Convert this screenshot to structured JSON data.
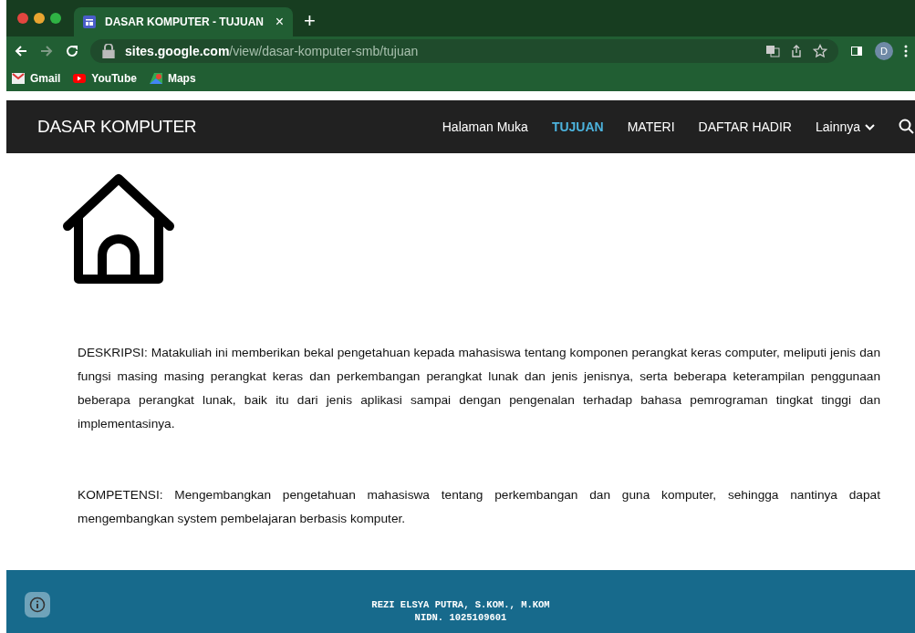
{
  "browser": {
    "tab_title": "DASAR KOMPUTER - TUJUAN",
    "tab_close": "×",
    "new_tab": "+",
    "url_host": "sites.google.com",
    "url_path": "/view/dasar-komputer-smb/tujuan",
    "profile_initial": "D",
    "bookmarks": [
      "Gmail",
      "YouTube",
      "Maps"
    ]
  },
  "site": {
    "title": "DASAR KOMPUTER",
    "nav": [
      {
        "label": "Halaman Muka",
        "selected": false
      },
      {
        "label": "TUJUAN",
        "selected": true
      },
      {
        "label": "MATERI",
        "selected": false
      },
      {
        "label": "DAFTAR HADIR",
        "selected": false
      },
      {
        "label": "Lainnya",
        "selected": false
      }
    ]
  },
  "paragraphs": [
    "DESKRIPSI: Matakuliah ini memberikan bekal pengetahuan kepada mahasiswa tentang komponen perangkat keras computer, meliputi jenis dan fungsi masing masing perangkat keras dan perkembangan perangkat lunak dan jenis jenisnya, serta beberapa keterampilan penggunaan beberapa perangkat lunak, baik itu dari jenis aplikasi sampai dengan pengenalan terhadap bahasa pemrograman tingkat tinggi dan implementasinya.",
    "KOMPETENSI: Mengembangkan pengetahuan mahasiswa tentang perkembangan dan guna komputer, sehingga nantinya dapat mengembangkan system pembelajaran berbasis komputer."
  ],
  "footer": [
    "REZI ELSYA PUTRA, S.KOM., M.KOM",
    "NIDN. 1025109601"
  ]
}
